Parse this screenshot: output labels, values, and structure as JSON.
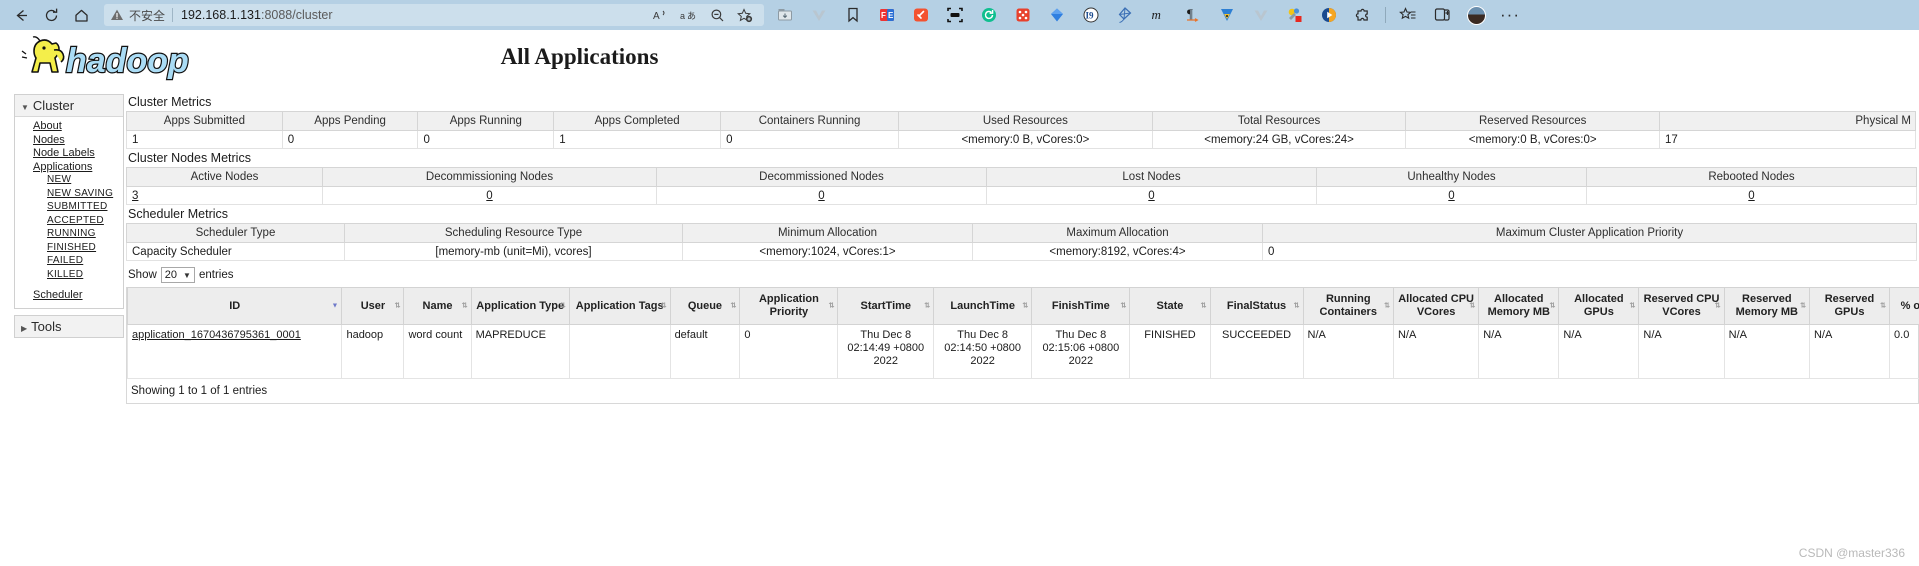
{
  "browser": {
    "back_icon": "back-arrow-icon",
    "reload_icon": "reload-icon",
    "home_icon": "home-icon",
    "security_label": "不安全",
    "url": "192.168.1.131:8088/cluster",
    "url_host": "192.168.1.131",
    "url_port": ":8088",
    "url_path": "/cluster",
    "read_aloud_icon": "read-aloud-icon",
    "translate_icon": "translate-icon",
    "zoom_out_icon": "zoom-out-icon",
    "add_favorite_icon": "add-favorite-icon",
    "collections_icon": "collections-icon",
    "favorites_icon": "favorites-list-icon",
    "split_screen_icon": "split-screen-icon",
    "profile_icon": "profile-avatar-icon",
    "settings_more_icon": "settings-and-more-icon",
    "extensions": [
      "downloads-icon",
      "vue-devtools-icon",
      "bookmark-icon",
      "fe-helper-icon",
      "adblock-icon",
      "qr-scanner-icon",
      "refresh-extension-icon",
      "dice-extension-icon",
      "blue-diamond-icon",
      "ocr-extension-icon",
      "kite-icon",
      "m-extension-icon",
      "paragraph-icon",
      "tampermonkey-icon",
      "vue-icon",
      "color-picker-icon",
      "media-player-icon",
      "puzzle-extensions-icon"
    ]
  },
  "header": {
    "logo_alt": "hadoop-logo",
    "title": "All Applications"
  },
  "sidebar": {
    "cluster": {
      "label": "Cluster",
      "links": [
        "About",
        "Nodes",
        "Node Labels",
        "Applications"
      ],
      "states": [
        "NEW",
        "NEW SAVING",
        "SUBMITTED",
        "ACCEPTED",
        "RUNNING",
        "FINISHED",
        "FAILED",
        "KILLED"
      ],
      "scheduler": "Scheduler"
    },
    "tools": {
      "label": "Tools"
    }
  },
  "cluster_metrics": {
    "title": "Cluster Metrics",
    "headers": [
      "Apps Submitted",
      "Apps Pending",
      "Apps Running",
      "Apps Completed",
      "Containers Running",
      "Used Resources",
      "Total Resources",
      "Reserved Resources",
      "Physical M"
    ],
    "values": [
      "1",
      "0",
      "0",
      "1",
      "0",
      "<memory:0 B, vCores:0>",
      "<memory:24 GB, vCores:24>",
      "<memory:0 B, vCores:0>",
      "17"
    ]
  },
  "nodes_metrics": {
    "title": "Cluster Nodes Metrics",
    "headers": [
      "Active Nodes",
      "Decommissioning Nodes",
      "Decommissioned Nodes",
      "Lost Nodes",
      "Unhealthy Nodes",
      "Rebooted Nodes"
    ],
    "values": [
      "3",
      "0",
      "0",
      "0",
      "0",
      "0"
    ]
  },
  "scheduler_metrics": {
    "title": "Scheduler Metrics",
    "headers": [
      "Scheduler Type",
      "Scheduling Resource Type",
      "Minimum Allocation",
      "Maximum Allocation",
      "Maximum Cluster Application Priority"
    ],
    "values": [
      "Capacity Scheduler",
      "[memory-mb (unit=Mi), vcores]",
      "<memory:1024, vCores:1>",
      "<memory:8192, vCores:4>",
      "0"
    ]
  },
  "apps_table": {
    "show_label": "Show",
    "show_value": "20",
    "entries_label": "entries",
    "headers": [
      "ID",
      "User",
      "Name",
      "Application Type",
      "Application Tags",
      "Queue",
      "Application Priority",
      "StartTime",
      "LaunchTime",
      "FinishTime",
      "State",
      "FinalStatus",
      "Running Containers",
      "Allocated CPU VCores",
      "Allocated Memory MB",
      "Allocated GPUs",
      "Reserved CPU VCores",
      "Reserved Memory MB",
      "Reserved GPUs",
      "% of Q"
    ],
    "rows": [
      {
        "id": "application_1670436795361_0001",
        "user": "hadoop",
        "name": "word count",
        "type": "MAPREDUCE",
        "tags": "",
        "queue": "default",
        "priority": "0",
        "start_time": "Thu Dec 8 02:14:49 +0800 2022",
        "launch_time": "Thu Dec 8 02:14:50 +0800 2022",
        "finish_time": "Thu Dec 8 02:15:06 +0800 2022",
        "state": "FINISHED",
        "final_status": "SUCCEEDED",
        "running_containers": "N/A",
        "alloc_cpu": "N/A",
        "alloc_mem": "N/A",
        "alloc_gpu": "N/A",
        "res_cpu": "N/A",
        "res_mem": "N/A",
        "res_gpu": "N/A",
        "pct_q": "0.0"
      }
    ],
    "footer": "Showing 1 to 1 of 1 entries"
  },
  "watermark": "CSDN @master336"
}
